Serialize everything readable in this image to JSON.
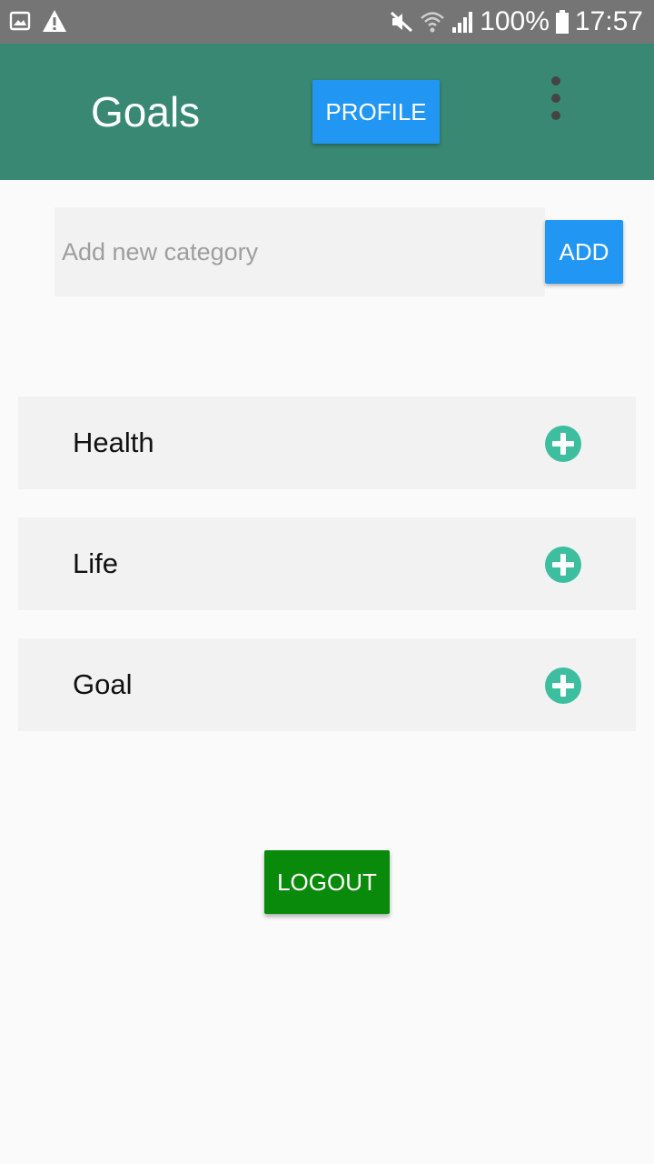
{
  "status_bar": {
    "icons": [
      "image-icon",
      "warning-icon",
      "mute-icon",
      "wifi-icon",
      "signal-icon",
      "battery-icon"
    ],
    "battery": "100%",
    "time": "17:57"
  },
  "app_bar": {
    "title": "Goals",
    "profile_label": "PROFILE",
    "color": "#388874"
  },
  "add_category": {
    "placeholder": "Add new category",
    "value": "",
    "add_label": "ADD"
  },
  "categories": [
    {
      "label": "Health"
    },
    {
      "label": "Life"
    },
    {
      "label": "Goal"
    }
  ],
  "logout_label": "LOGOUT",
  "colors": {
    "accent_blue": "#2196f3",
    "plus_icon": "#3dbf9f",
    "logout_green": "#0a8a0a"
  }
}
